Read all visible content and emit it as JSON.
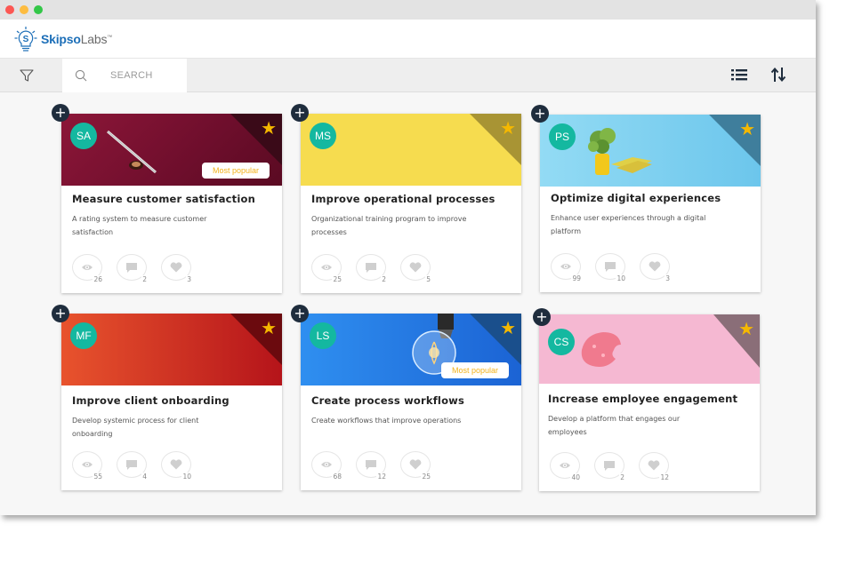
{
  "brand": {
    "name_bold": "Skipso",
    "name_light": "Labs",
    "mark": "™"
  },
  "toolbar": {
    "search_placeholder": "SEARCH"
  },
  "cards": [
    {
      "initials": "SA",
      "title": "Measure customer satisfaction",
      "description": "A rating system to measure customer satisfaction",
      "badge": "Most popular",
      "views": "26",
      "comments": "2",
      "likes": "3",
      "banner_color": "#7a1030"
    },
    {
      "initials": "MS",
      "title": "Improve operational processes",
      "description": "Organizational training program to improve processes",
      "badge": "",
      "views": "25",
      "comments": "2",
      "likes": "5",
      "banner_color": "#f6dc4f"
    },
    {
      "initials": "PS",
      "title": "Optimize digital experiences",
      "description": "Enhance user experiences through a digital platform",
      "badge": "",
      "views": "99",
      "comments": "10",
      "likes": "3",
      "banner_color": "#7cd0ef"
    },
    {
      "initials": "MF",
      "title": "Improve client onboarding",
      "description": "Develop systemic process for client onboarding",
      "badge": "",
      "views": "55",
      "comments": "4",
      "likes": "10",
      "banner_color": "#d8312a"
    },
    {
      "initials": "LS",
      "title": "Create process workflows",
      "description": "Create workflows that improve operations",
      "badge": "Most popular",
      "views": "68",
      "comments": "12",
      "likes": "25",
      "banner_color": "#2a7ee6"
    },
    {
      "initials": "CS",
      "title": "Increase employee engagement",
      "description": "Develop a platform that engages our employees",
      "badge": "",
      "views": "40",
      "comments": "2",
      "likes": "12",
      "banner_color": "#f5b8d2"
    }
  ],
  "colors": {
    "accent": "#14b8a0",
    "star": "#f5b800",
    "badge_text": "#f2b21b",
    "plus_bg": "#1f2d3d"
  },
  "icons": [
    "filter-icon",
    "search-icon",
    "list-view-icon",
    "sort-icon",
    "plus-icon",
    "star-icon",
    "eye-icon",
    "comment-icon",
    "heart-icon"
  ]
}
